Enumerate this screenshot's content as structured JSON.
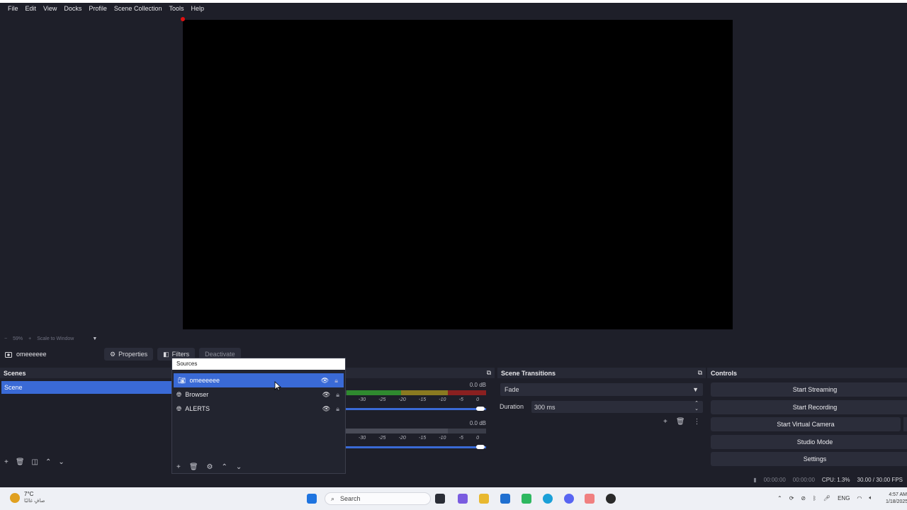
{
  "menu": [
    "File",
    "Edit",
    "View",
    "Docks",
    "Profile",
    "Scene Collection",
    "Tools",
    "Help"
  ],
  "zoom": {
    "percent": "59%",
    "scale_label": "Scale to Window"
  },
  "source_toolbar": {
    "name": "omeeeeee",
    "properties": "Properties",
    "filters": "Filters",
    "deactivate": "Deactivate"
  },
  "scenes": {
    "title": "Scenes",
    "items": [
      "Scene"
    ]
  },
  "sources_popup": {
    "title": "Sources",
    "items": [
      {
        "label": "omeeeeee",
        "selected": true
      },
      {
        "label": "Browser",
        "selected": false
      },
      {
        "label": "ALERTS",
        "selected": false
      }
    ]
  },
  "mixer": {
    "tracks": [
      {
        "db": "0.0 dB",
        "ticks": [
          "-30",
          "-25",
          "-20",
          "-15",
          "-10",
          "-5",
          "0"
        ]
      },
      {
        "db": "0.0 dB",
        "ticks": [
          "-30",
          "-25",
          "-20",
          "-15",
          "-10",
          "-5",
          "0"
        ]
      }
    ]
  },
  "transitions": {
    "title": "Scene Transitions",
    "selected": "Fade",
    "duration_label": "Duration",
    "duration_value": "300 ms"
  },
  "controls": {
    "title": "Controls",
    "start_streaming": "Start Streaming",
    "start_recording": "Start Recording",
    "start_virtual_camera": "Start Virtual Camera",
    "studio_mode": "Studio Mode",
    "settings": "Settings"
  },
  "status": {
    "stream_time": "00:00:00",
    "rec_time": "00:00:00",
    "cpu": "CPU: 1.3%",
    "fps": "30.00 / 30.00 FPS"
  },
  "taskbar": {
    "weather_temp": "7°C",
    "weather_desc": "صافٍ غالبًا",
    "search_placeholder": "Search",
    "lang": "ENG",
    "time": "4:57 AM",
    "date": "1/18/2025"
  },
  "colors": {
    "accent": "#3a6ad6",
    "background": "#1e1f29",
    "panel_header": "#272935",
    "button": "#2b2d3a"
  }
}
